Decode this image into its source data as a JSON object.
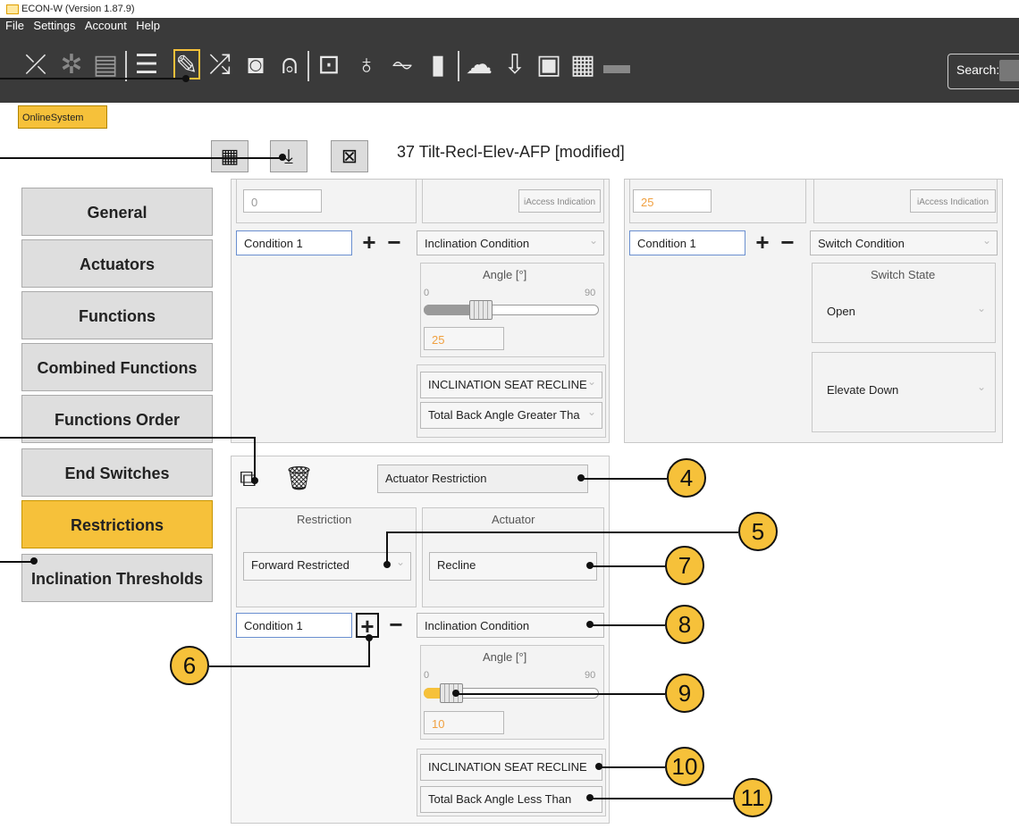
{
  "window": {
    "title": "ECON-W (Version 1.87.9)"
  },
  "menu": [
    "File",
    "Settings",
    "Account",
    "Help"
  ],
  "toolbar": {
    "icons": [
      "disconnect-icon",
      "bluetooth-off-icon",
      "cast-icon",
      "list-icon",
      "edit-document-icon",
      "shuffle-icon",
      "camera-plus-icon",
      "remote-icon",
      "monitor-icon",
      "stethoscope-icon",
      "waveform-icon",
      "battery-icon",
      "cloud-icon",
      "download-icon",
      "image-icon",
      "clipboard-icon",
      "comment-icon"
    ],
    "search_label": "Search:"
  },
  "tab": "OnlineSystem",
  "doc_title": "37 Tilt-Recl-Elev-AFP [modified]",
  "nav": [
    "General",
    "Actuators",
    "Functions",
    "Combined Functions",
    "Functions Order",
    "End Switches",
    "Restrictions",
    "Inclination Thresholds"
  ],
  "nav_active": "Restrictions",
  "top_left": {
    "value_field": "0",
    "iaccess": "iAccess Indication",
    "condition": "Condition 1",
    "condition_type": "Inclination Condition",
    "angle_label": "Angle  [°]",
    "scale_min": "0",
    "scale_max": "90",
    "angle_value": "25",
    "slider_fraction": 0.28,
    "sensor": "INCLINATION SEAT RECLINE",
    "comparison": "Total Back Angle Greater Tha"
  },
  "top_right": {
    "value_field": "25",
    "iaccess": "iAccess Indication",
    "condition": "Condition 1",
    "condition_type": "Switch Condition",
    "switch_state_label": "Switch State",
    "switch_state": "Open",
    "action": "Elevate Down"
  },
  "restriction": {
    "type_field": "Actuator Restriction",
    "restriction_label": "Restriction",
    "restriction_value": "Forward Restricted",
    "actuator_label": "Actuator",
    "actuator_value": "Recline",
    "condition": "Condition 1",
    "condition_type": "Inclination Condition",
    "angle_label": "Angle  [°]",
    "scale_min": "0",
    "scale_max": "90",
    "angle_value": "10",
    "slider_fraction": 0.11,
    "sensor": "INCLINATION SEAT RECLINE",
    "comparison": "Total Back Angle Less Than"
  },
  "callouts": [
    "4",
    "5",
    "6",
    "7",
    "8",
    "9",
    "10",
    "11"
  ],
  "colors": {
    "accent": "#f6c13a",
    "toolbar": "#3a3a3a",
    "orange_text": "#f0a040"
  }
}
